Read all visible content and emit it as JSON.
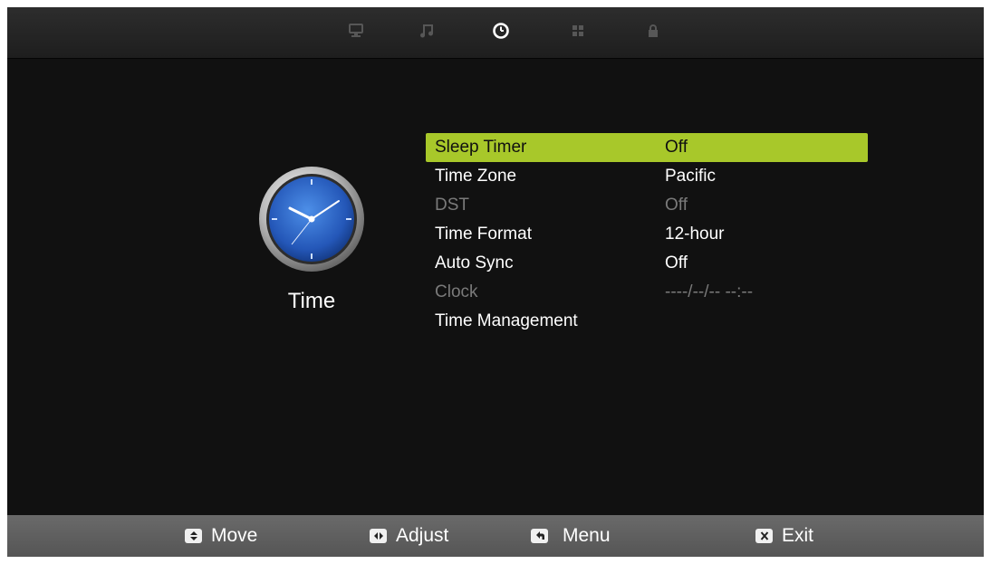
{
  "tabs": [
    {
      "icon": "monitor-icon",
      "active": false
    },
    {
      "icon": "music-note-icon",
      "active": false
    },
    {
      "icon": "clock-icon",
      "active": true
    },
    {
      "icon": "grid-icon",
      "active": false
    },
    {
      "icon": "lock-icon",
      "active": false
    }
  ],
  "page": {
    "title": "Time",
    "icon": "clock-icon"
  },
  "menu": {
    "items": [
      {
        "label": "Sleep Timer",
        "value": "Off",
        "state": "selected"
      },
      {
        "label": "Time Zone",
        "value": "Pacific",
        "state": "normal"
      },
      {
        "label": "DST",
        "value": "Off",
        "state": "disabled"
      },
      {
        "label": "Time Format",
        "value": "12-hour",
        "state": "normal"
      },
      {
        "label": "Auto Sync",
        "value": "Off",
        "state": "normal"
      },
      {
        "label": "Clock",
        "value": "----/--/-- --:--",
        "state": "disabled"
      },
      {
        "label": "Time Management",
        "value": "",
        "state": "normal"
      }
    ]
  },
  "hints": [
    {
      "key_icon": "up-down-key-icon",
      "label": "Move"
    },
    {
      "key_icon": "left-right-key-icon",
      "label": "Adjust"
    },
    {
      "key_icon": "menu-return-key-icon",
      "label": "Menu"
    },
    {
      "key_icon": "x-key-icon",
      "label": "Exit"
    }
  ],
  "colors": {
    "highlight": "#a8c82a",
    "background": "#111111",
    "disabled_text": "#7a7a7a",
    "active_tab": "#ffffff",
    "inactive_tab": "#555555",
    "clock_face": "#2a66c4"
  }
}
